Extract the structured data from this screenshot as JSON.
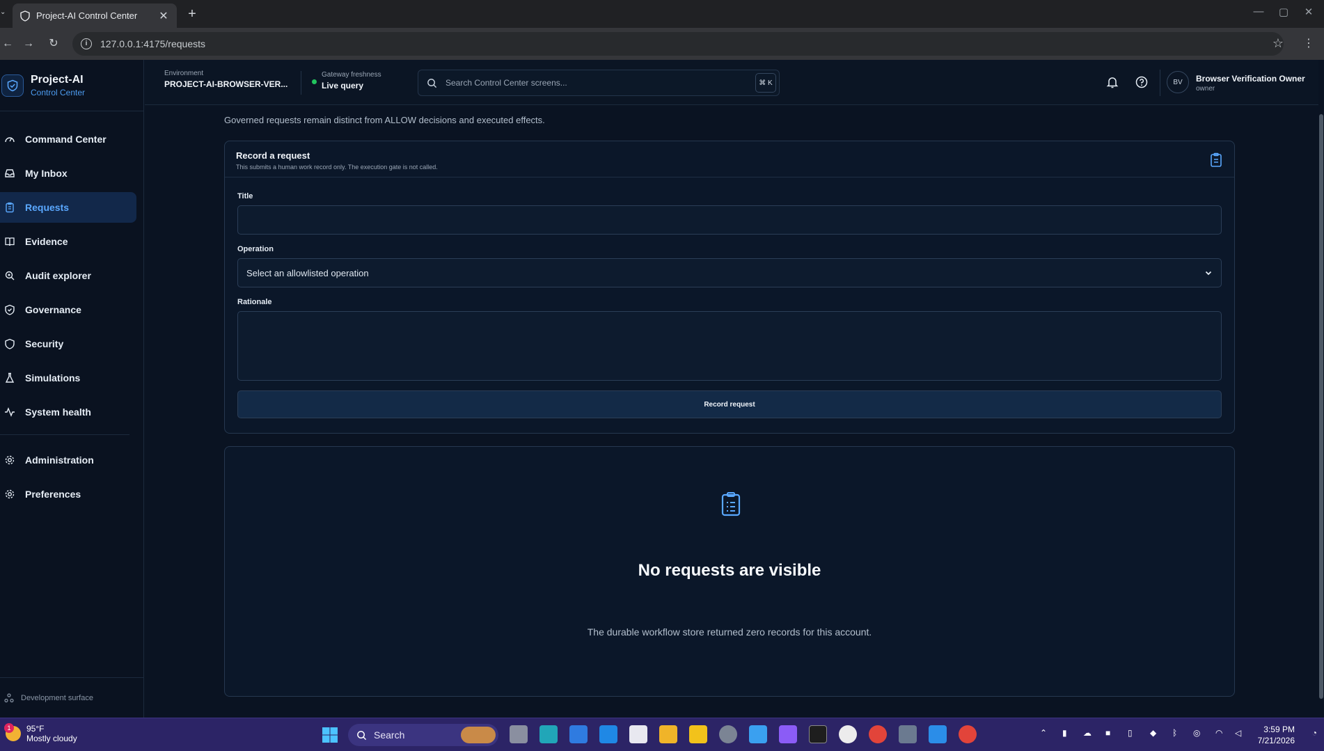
{
  "browser": {
    "tab_title": "Project-AI Control Center",
    "url": "127.0.0.1:4175/requests"
  },
  "brand": {
    "name": "Project-AI",
    "subtitle": "Control Center"
  },
  "sidebar": {
    "items": [
      {
        "label": "Command Center",
        "icon": "gauge-icon"
      },
      {
        "label": "My Inbox",
        "icon": "inbox-icon"
      },
      {
        "label": "Requests",
        "icon": "clipboard-icon",
        "active": true
      },
      {
        "label": "Evidence",
        "icon": "book-icon"
      },
      {
        "label": "Audit explorer",
        "icon": "audit-search-icon"
      },
      {
        "label": "Governance",
        "icon": "shield-check-icon"
      },
      {
        "label": "Security",
        "icon": "shield-icon"
      },
      {
        "label": "Simulations",
        "icon": "flask-icon"
      },
      {
        "label": "System health",
        "icon": "activity-icon"
      }
    ],
    "secondary": [
      {
        "label": "Administration",
        "icon": "gear-icon"
      },
      {
        "label": "Preferences",
        "icon": "gear-icon"
      }
    ],
    "footer": "Development surface"
  },
  "topbar": {
    "env_label": "Environment",
    "env_value": "PROJECT-AI-BROWSER-VER...",
    "fresh_label": "Gateway freshness",
    "fresh_value": "Live query",
    "search_placeholder": "Search Control Center screens...",
    "search_shortcut": "⌘ K",
    "user_initials": "BV",
    "user_name": "Browser Verification Owner",
    "user_role": "owner"
  },
  "page": {
    "description": "Governed requests remain distinct from ALLOW decisions and executed effects."
  },
  "form": {
    "title": "Record a request",
    "subtitle": "This submits a human work record only. The execution gate is not called.",
    "title_label": "Title",
    "title_value": "",
    "operation_label": "Operation",
    "operation_value": "Select an allowlisted operation",
    "rationale_label": "Rationale",
    "rationale_value": "",
    "submit_label": "Record request"
  },
  "empty_state": {
    "title": "No requests are visible",
    "text": "The durable workflow store returned zero records for this account."
  },
  "taskbar": {
    "weather_temp": "95°F",
    "weather_cond": "Mostly cloudy",
    "weather_badge": "1",
    "search_label": "Search",
    "time": "3:59 PM",
    "date": "7/21/2026"
  },
  "colors": {
    "accent": "#5aa8ff",
    "active_bg": "#12284a",
    "status_live": "#22c55e",
    "taskbar": "#2c2466"
  }
}
